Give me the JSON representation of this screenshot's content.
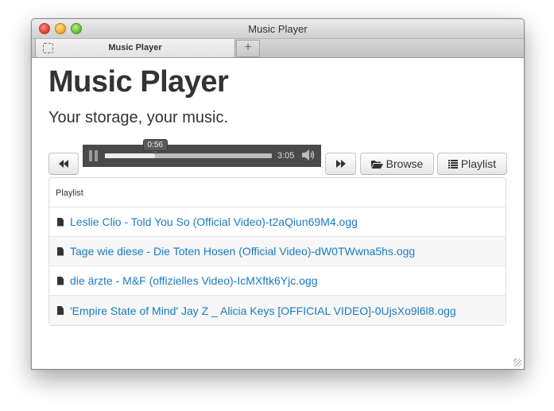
{
  "window": {
    "title": "Music Player"
  },
  "tabs": [
    {
      "label": "Music Player"
    }
  ],
  "newtab": {
    "label": "+"
  },
  "page": {
    "heading": "Music Player",
    "subtitle": "Your storage, your music."
  },
  "player": {
    "current_time": "0:56",
    "duration": "3:05",
    "progress": 0.3,
    "prev_icon": "backward-icon",
    "pause_icon": "pause-icon",
    "volume_icon": "volume-icon",
    "next_icon": "forward-icon"
  },
  "toolbar": {
    "browse_label": "Browse",
    "playlist_label": "Playlist"
  },
  "playlist": {
    "heading": "Playlist",
    "items": [
      "Leslie Clio - Told You So (Official Video)-t2aQiun69M4.ogg",
      "Tage wie diese - Die Toten Hosen (Official Video)-dW0TWwna5hs.ogg",
      "die ärzte - M&F (offizielles Video)-IcMXftk6Yjc.ogg",
      "'Empire State of Mind' Jay Z _ Alicia Keys [OFFICIAL VIDEO]-0UjsXo9l6l8.ogg"
    ]
  },
  "colors": {
    "link": "#1a7bc0",
    "player_bg": "#4a4a4a"
  }
}
